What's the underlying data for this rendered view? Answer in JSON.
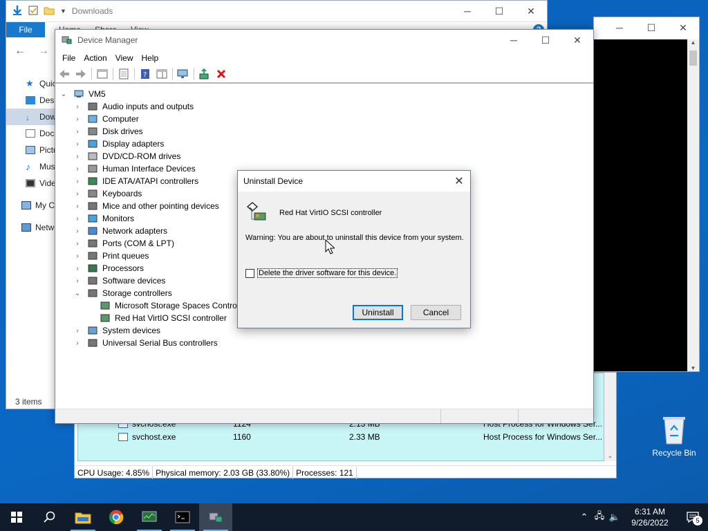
{
  "explorer": {
    "title": "Downloads",
    "ribbon_file": "File",
    "ribbon_tabs": [
      "Home",
      "Share",
      "View"
    ],
    "sidebar": [
      "Quick access",
      "Desktop",
      "Downloads",
      "Documents",
      "Pictures",
      "Music",
      "Videos",
      "My Computer",
      "Network"
    ],
    "status": "3 items"
  },
  "device_manager": {
    "title": "Device Manager",
    "menu": [
      "File",
      "Action",
      "View",
      "Help"
    ],
    "root": "VM5",
    "categories": [
      "Audio inputs and outputs",
      "Computer",
      "Disk drives",
      "Display adapters",
      "DVD/CD-ROM drives",
      "Human Interface Devices",
      "IDE ATA/ATAPI controllers",
      "Keyboards",
      "Mice and other pointing devices",
      "Monitors",
      "Network adapters",
      "Ports (COM & LPT)",
      "Print queues",
      "Processors",
      "Software devices",
      "Storage controllers",
      "System devices",
      "Universal Serial Bus controllers"
    ],
    "storage_children": [
      "Microsoft Storage Spaces Controller",
      "Red Hat VirtIO SCSI controller"
    ]
  },
  "dialog": {
    "title": "Uninstall Device",
    "device_name": "Red Hat VirtIO SCSI controller",
    "warning": "Warning: You are about to uninstall this device from your system.",
    "checkbox_label": "Delete the driver software for this device.",
    "uninstall": "Uninstall",
    "cancel": "Cancel"
  },
  "task_manager": {
    "rows": [
      {
        "name": "svchost.exe",
        "pid": "1124",
        "memory": "2.13 MB",
        "desc": "Host Process for Windows Ser..."
      },
      {
        "name": "svchost.exe",
        "pid": "1160",
        "memory": "2.33 MB",
        "desc": "Host Process for Windows Ser..."
      }
    ],
    "cpu": "CPU Usage: 4.85%",
    "memory": "Physical memory: 2.03 GB (33.80%)",
    "processes": "Processes: 121"
  },
  "desktop": {
    "recycle_bin": "Recycle Bin"
  },
  "taskbar": {
    "time": "6:31 AM",
    "date": "9/26/2022",
    "notifications": "5"
  },
  "colors": {
    "accent": "#0078d7",
    "desktop": "#0a63b8",
    "taskbar": "#101b2b",
    "taskmgr_highlight": "#c8f5f6"
  }
}
